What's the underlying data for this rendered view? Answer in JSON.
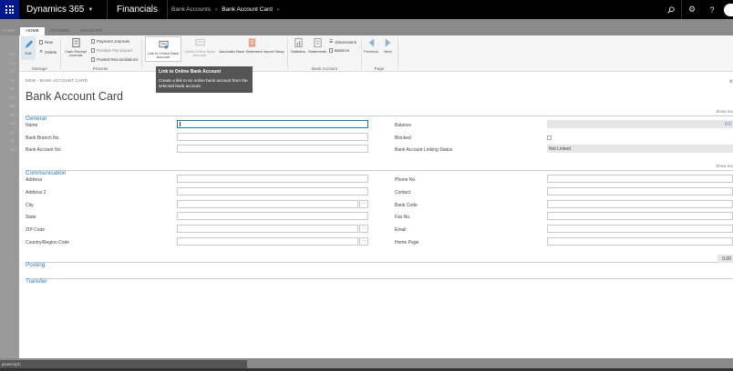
{
  "topbar": {
    "brand": "Dynamics 365",
    "app": "Financials",
    "breadcrumb": [
      "Bank Accounts",
      "Bank Account Card"
    ]
  },
  "ribbon_tabs": {
    "ghost": "HOME",
    "home": "HOME",
    "actions": "ACTIONS",
    "navigate": "NAVIGATE"
  },
  "left_panel": [
    "Ro",
    "Cu",
    "Ch",
    "Ve",
    "Ite",
    "Pu",
    "Ba",
    "Re",
    "Ca",
    "Jo",
    "Ja",
    "Ge"
  ],
  "ribbon": {
    "manage": {
      "label": "Manage",
      "edit": "Edit",
      "new": "New",
      "delete": "Delete"
    },
    "process": {
      "label": "Process",
      "cash_receipt": "Cash Receipt Journals",
      "payment_journals": "Payment Journals",
      "positive_pay": "Positive Pay Export",
      "posted_recon": "Posted Reconciliations"
    },
    "link": {
      "link_online": "Link to Online Bank Account",
      "unlink_online": "Unlink Online Bank Account",
      "auto_import": "Automatic Bank Statement Import Setup"
    },
    "bank_account": {
      "label": "Bank Account",
      "statistics": "Statistics",
      "statements": "Statements",
      "dimensions": "Dimensions",
      "balance": "Balance"
    },
    "page": {
      "label": "Page",
      "previous": "Previous",
      "next": "Next"
    }
  },
  "tooltip": {
    "title": "Link to Online Bank Account",
    "body": "Create a link to an online bank account from the selected bank account."
  },
  "page": {
    "crumb": "NEW - BANK ACCOUNT CARD",
    "title": "Bank Account Card"
  },
  "general": {
    "header": "General",
    "show_more": "Show mo",
    "name": "Name",
    "branch_no": "Bank Branch No.",
    "account_no": "Bank Account No.",
    "balance_label": "Balance",
    "balance_value": "0.0",
    "blocked": "Blocked",
    "linking_status_label": "Bank Account Linking Status",
    "linking_status_value": "Not Linked"
  },
  "communication": {
    "header": "Communication",
    "show_more": "Show mo",
    "address": "Address",
    "address2": "Address 2",
    "city": "City",
    "state": "State",
    "zip": "ZIP Code",
    "country": "Country/Region Code",
    "phone": "Phone No.",
    "contact": "Contact",
    "bank_code": "Bank Code",
    "fax": "Fax No.",
    "email": "Email",
    "home_page": "Home Page",
    "lookup": "..."
  },
  "posting": {
    "header": "Posting",
    "value": "0.00"
  },
  "transfer": {
    "header": "Transfer"
  },
  "statusbar": "javascript:;",
  "colors": {
    "accent": "#1e7bb8",
    "waffle": "#00188f",
    "topbar": "#000000"
  }
}
